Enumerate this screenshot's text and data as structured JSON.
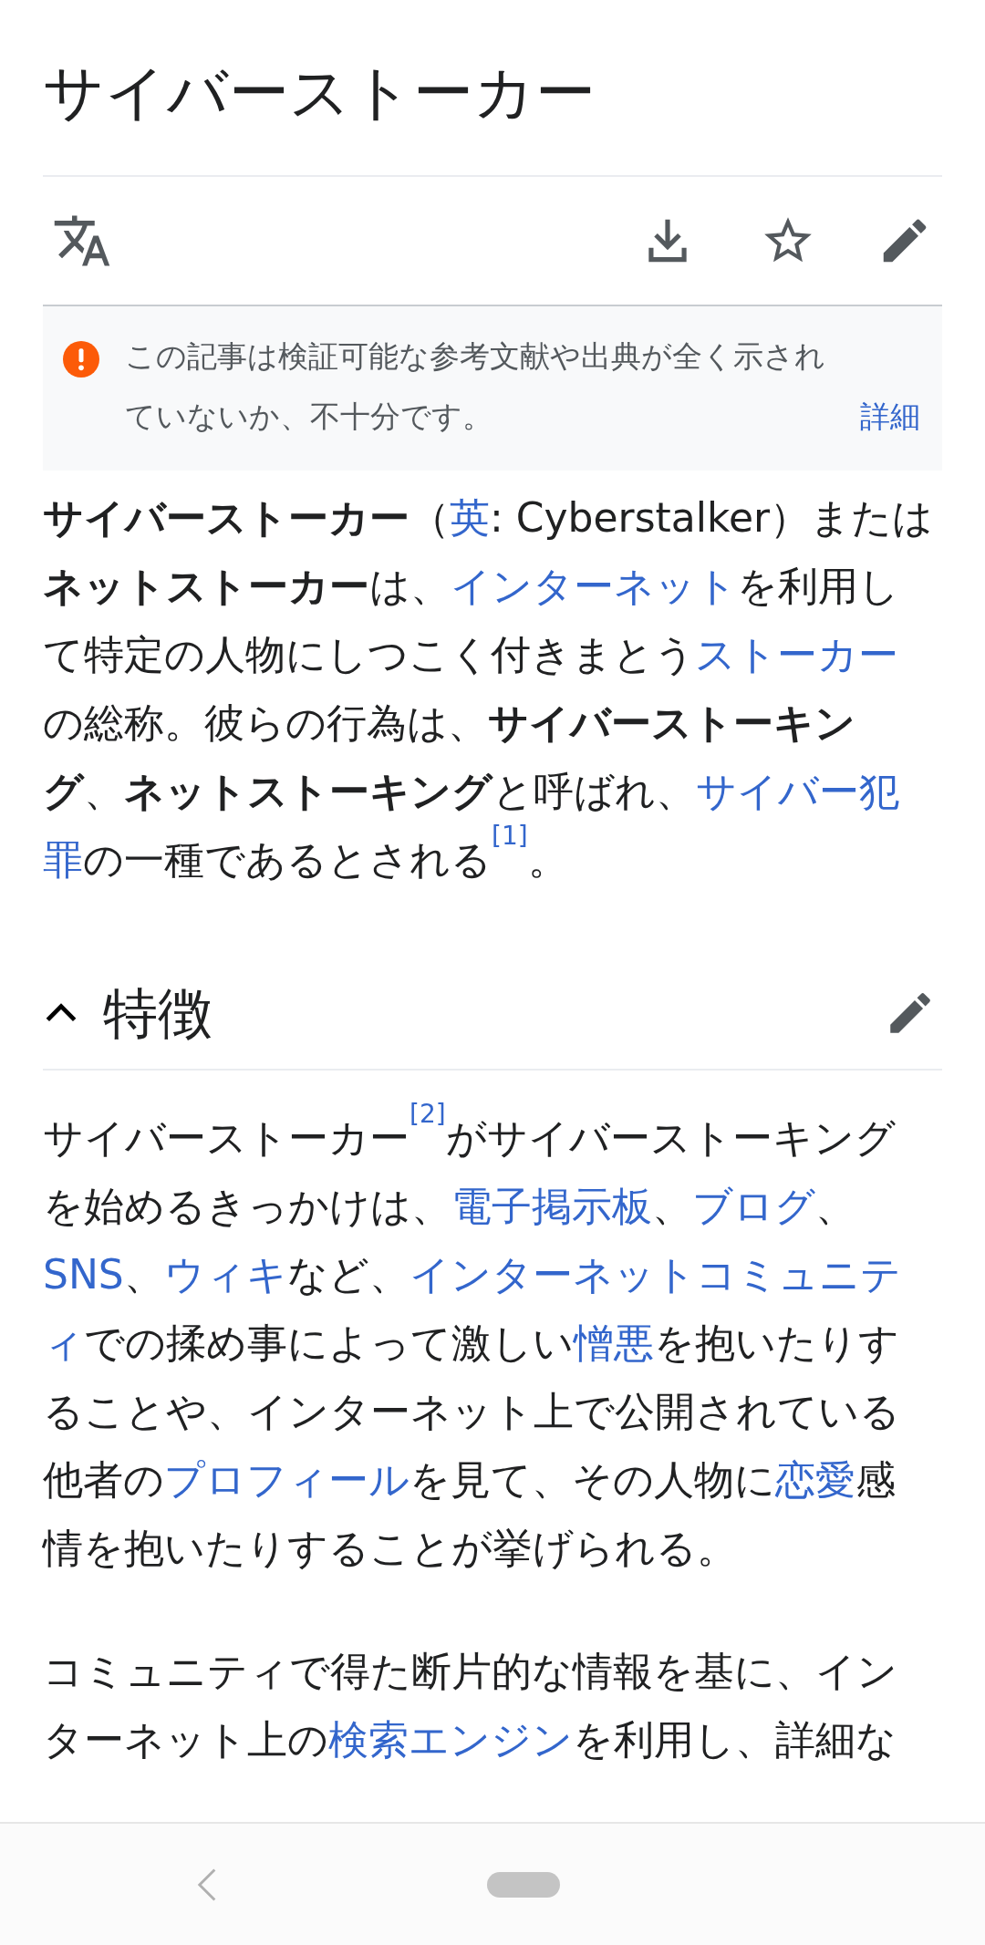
{
  "title": "サイバーストーカー",
  "notice": {
    "lines": [
      "この記事は検証可能な参考文献や出典が全く示され",
      "ていないか、不十分です。"
    ],
    "link": "詳細"
  },
  "intro": {
    "lines": [
      [
        {
          "kind": "bold",
          "text": "サイバーストーカー"
        },
        {
          "kind": "text",
          "text": "（"
        },
        {
          "kind": "link",
          "text": "英"
        },
        {
          "kind": "text",
          "text": ": Cyberstalker）または"
        }
      ],
      [
        {
          "kind": "bold",
          "text": "ネットストーカー"
        },
        {
          "kind": "text",
          "text": "は、"
        },
        {
          "kind": "link",
          "text": "インターネット"
        },
        {
          "kind": "text",
          "text": "を利用し"
        }
      ],
      [
        {
          "kind": "text",
          "text": "て特定の人物にしつこく付きまとう"
        },
        {
          "kind": "link",
          "text": "ストーカー"
        }
      ],
      [
        {
          "kind": "text",
          "text": "の総称。彼らの行為は、"
        },
        {
          "kind": "bold",
          "text": "サイバーストーキン"
        }
      ],
      [
        {
          "kind": "bold",
          "text": "グ"
        },
        {
          "kind": "text",
          "text": "、"
        },
        {
          "kind": "bold",
          "text": "ネットストーキング"
        },
        {
          "kind": "text",
          "text": "と呼ばれ、"
        },
        {
          "kind": "link",
          "text": "サイバー犯"
        }
      ],
      [
        {
          "kind": "link",
          "text": "罪"
        },
        {
          "kind": "text",
          "text": "の一種であるとされる"
        },
        {
          "kind": "ref",
          "text": "[1]"
        },
        {
          "kind": "text",
          "text": "。"
        }
      ]
    ]
  },
  "section": {
    "heading": "特徴",
    "expanded": true,
    "paragraphs": [
      {
        "lines": [
          [
            {
              "kind": "text",
              "text": "サイバーストーカー"
            },
            {
              "kind": "ref",
              "text": "[2]"
            },
            {
              "kind": "text",
              "text": "がサイバーストーキング"
            }
          ],
          [
            {
              "kind": "text",
              "text": "を始めるきっかけは、"
            },
            {
              "kind": "link",
              "text": "電子掲示板"
            },
            {
              "kind": "text",
              "text": "、"
            },
            {
              "kind": "link",
              "text": "ブログ"
            },
            {
              "kind": "text",
              "text": "、"
            }
          ],
          [
            {
              "kind": "link",
              "text": "SNS"
            },
            {
              "kind": "text",
              "text": "、"
            },
            {
              "kind": "link",
              "text": "ウィキ"
            },
            {
              "kind": "text",
              "text": "など、"
            },
            {
              "kind": "link",
              "text": "インターネットコミュニテ"
            }
          ],
          [
            {
              "kind": "link",
              "text": "ィ"
            },
            {
              "kind": "text",
              "text": "での揉め事によって激しい"
            },
            {
              "kind": "link",
              "text": "憎悪"
            },
            {
              "kind": "text",
              "text": "を抱いたりす"
            }
          ],
          [
            {
              "kind": "text",
              "text": "ることや、インターネット上で公開されている"
            }
          ],
          [
            {
              "kind": "text",
              "text": "他者の"
            },
            {
              "kind": "link",
              "text": "プロフィール"
            },
            {
              "kind": "text",
              "text": "を見て、その人物に"
            },
            {
              "kind": "link",
              "text": "恋愛"
            },
            {
              "kind": "text",
              "text": "感"
            }
          ],
          [
            {
              "kind": "text",
              "text": "情を抱いたりすることが挙げられる。"
            }
          ]
        ]
      },
      {
        "lines": [
          [
            {
              "kind": "text",
              "text": "コミュニティで得た断片的な情報を基に、イン"
            }
          ],
          [
            {
              "kind": "text",
              "text": "ターネット上の"
            },
            {
              "kind": "link",
              "text": "検索エンジン"
            },
            {
              "kind": "text",
              "text": "を利用し、詳細な"
            }
          ]
        ]
      }
    ]
  }
}
